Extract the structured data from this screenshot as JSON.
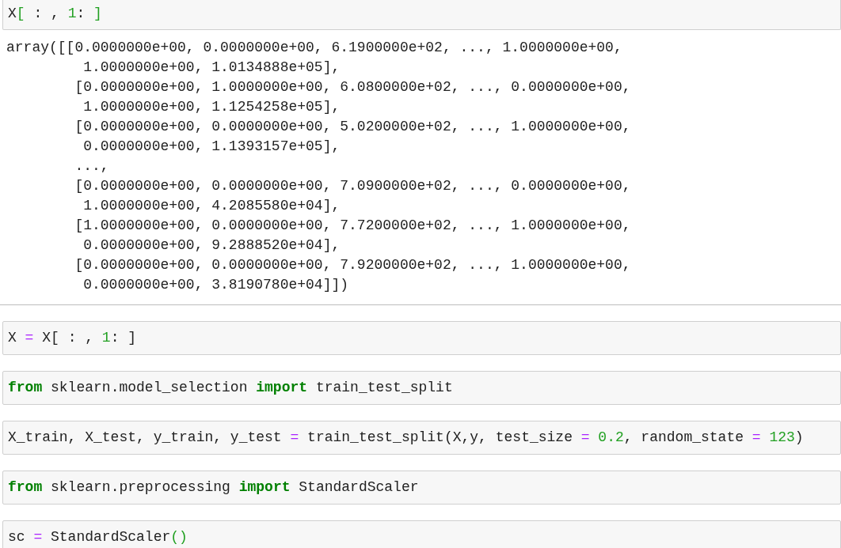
{
  "cells": [
    {
      "input": [
        {
          "kind": "plain",
          "text": "X"
        },
        {
          "kind": "match",
          "text": "["
        },
        {
          "kind": "plain",
          "text": " : , "
        },
        {
          "kind": "number",
          "text": "1"
        },
        {
          "kind": "plain",
          "text": ": "
        },
        {
          "kind": "match",
          "text": "]"
        }
      ],
      "output": [
        "array([[0.0000000e+00, 0.0000000e+00, 6.1900000e+02, ..., 1.0000000e+00,",
        "         1.0000000e+00, 1.0134888e+05],",
        "        [0.0000000e+00, 1.0000000e+00, 6.0800000e+02, ..., 0.0000000e+00,",
        "         1.0000000e+00, 1.1254258e+05],",
        "        [0.0000000e+00, 0.0000000e+00, 5.0200000e+02, ..., 1.0000000e+00,",
        "         0.0000000e+00, 1.1393157e+05],",
        "        ...,",
        "        [0.0000000e+00, 0.0000000e+00, 7.0900000e+02, ..., 0.0000000e+00,",
        "         1.0000000e+00, 4.2085580e+04],",
        "        [1.0000000e+00, 0.0000000e+00, 7.7200000e+02, ..., 1.0000000e+00,",
        "         0.0000000e+00, 9.2888520e+04],",
        "        [0.0000000e+00, 0.0000000e+00, 7.9200000e+02, ..., 1.0000000e+00,",
        "         0.0000000e+00, 3.8190780e+04]])"
      ]
    },
    {
      "input": [
        {
          "kind": "plain",
          "text": "X "
        },
        {
          "kind": "operator",
          "text": "="
        },
        {
          "kind": "plain",
          "text": " X[ : , "
        },
        {
          "kind": "number",
          "text": "1"
        },
        {
          "kind": "plain",
          "text": ": ]"
        }
      ]
    },
    {
      "input": [
        {
          "kind": "keyword",
          "text": "from"
        },
        {
          "kind": "plain",
          "text": " sklearn.model_selection "
        },
        {
          "kind": "keyword",
          "text": "import"
        },
        {
          "kind": "plain",
          "text": " train_test_split"
        }
      ]
    },
    {
      "input": [
        {
          "kind": "plain",
          "text": "X_train, X_test, y_train, y_test "
        },
        {
          "kind": "operator",
          "text": "="
        },
        {
          "kind": "plain",
          "text": " train_test_split(X,y, test_size "
        },
        {
          "kind": "operator",
          "text": "= "
        },
        {
          "kind": "number",
          "text": "0.2"
        },
        {
          "kind": "plain",
          "text": ", random_state "
        },
        {
          "kind": "operator",
          "text": "= "
        },
        {
          "kind": "number",
          "text": "123"
        },
        {
          "kind": "plain",
          "text": ")"
        }
      ]
    },
    {
      "input": [
        {
          "kind": "keyword",
          "text": "from"
        },
        {
          "kind": "plain",
          "text": " sklearn.preprocessing "
        },
        {
          "kind": "keyword",
          "text": "import"
        },
        {
          "kind": "plain",
          "text": " StandardScaler"
        }
      ]
    },
    {
      "input": [
        {
          "kind": "plain",
          "text": "sc "
        },
        {
          "kind": "operator",
          "text": "="
        },
        {
          "kind": "plain",
          "text": " StandardScaler"
        },
        {
          "kind": "match",
          "text": "()"
        }
      ]
    }
  ]
}
